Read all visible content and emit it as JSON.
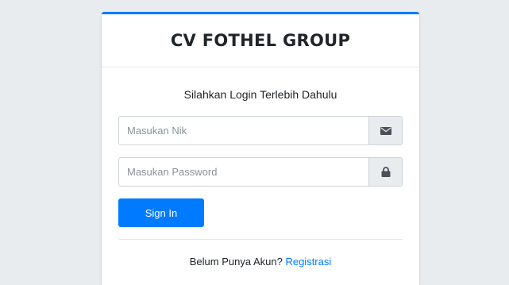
{
  "header": {
    "title": "CV FOTHEL GROUP"
  },
  "login": {
    "message": "Silahkan Login Terlebih Dahulu",
    "nik_placeholder": "Masukan Nik",
    "password_placeholder": "Masukan Password",
    "nik_icon": "envelope-icon",
    "password_icon": "lock-icon",
    "submit_label": "Sign In"
  },
  "register": {
    "prompt": "Belum Punya Akun?",
    "link_label": "Registrasi"
  },
  "colors": {
    "accent": "#007bff",
    "background": "#e9ecef"
  }
}
